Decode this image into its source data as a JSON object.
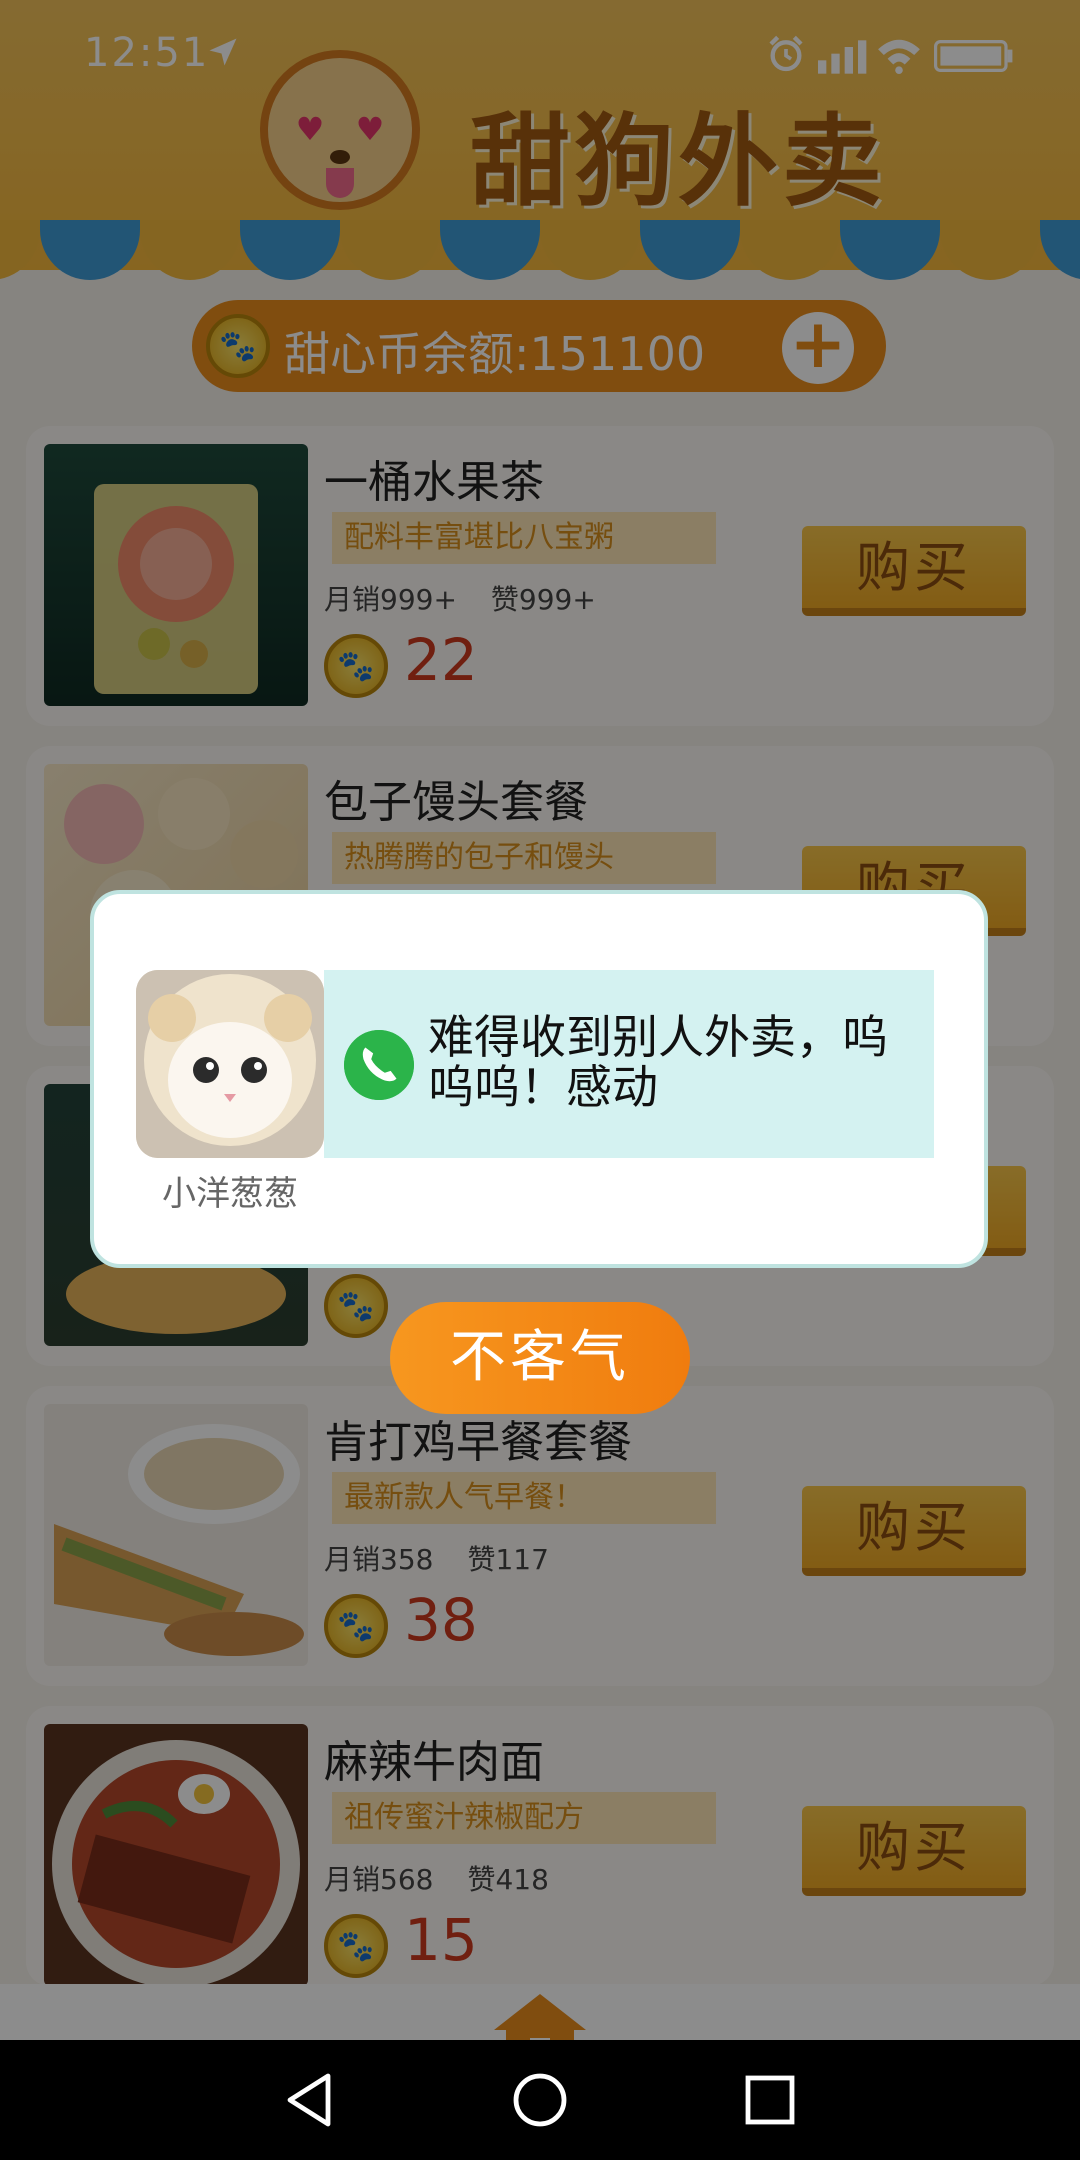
{
  "status_bar": {
    "time": "12:51"
  },
  "brand": {
    "name": "甜狗外卖"
  },
  "balance": {
    "label": "甜心币余额:151100"
  },
  "products": [
    {
      "name": "一桶水果茶",
      "tagline": "配料丰富堪比八宝粥",
      "monthly_sales": "月销999+",
      "likes": "赞999+",
      "price": "22",
      "buy_label": "购买"
    },
    {
      "name": "包子馒头套餐",
      "tagline": "热腾腾的包子和馒头",
      "buy_label": "购买"
    },
    {
      "buy_label": "购买"
    },
    {
      "name": "肯打鸡早餐套餐",
      "tagline": "最新款人气早餐！",
      "monthly_sales": "月销358",
      "likes": "赞117",
      "price": "38",
      "buy_label": "购买"
    },
    {
      "name": "麻辣牛肉面",
      "tagline": "祖传蜜汁辣椒配方",
      "monthly_sales": "月销568",
      "likes": "赞418",
      "price": "15",
      "buy_label": "购买"
    }
  ],
  "dialog": {
    "sender_name": "小洋葱葱",
    "message": "难得收到别人外卖，呜呜呜！感动",
    "confirm_label": "不客气"
  },
  "colors": {
    "accent": "#F07C0E",
    "header": "#F6B83B",
    "price": "#CC3A1E",
    "dialog_message_bg": "#D4F2F1"
  }
}
